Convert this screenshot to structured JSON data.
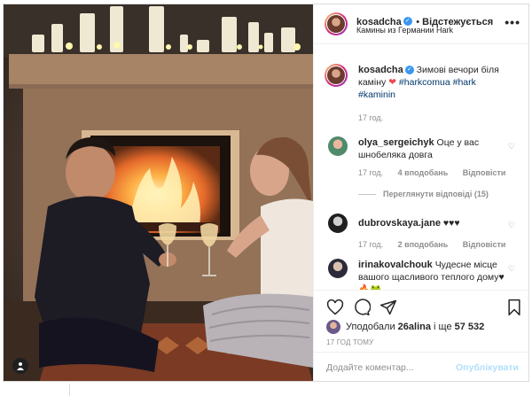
{
  "post": {
    "username": "kosadcha",
    "follow_label": "Відстежується",
    "location": "Камины из Германии Hark",
    "caption_user": "kosadcha",
    "caption_text": "Зимові вечори біля каміну",
    "caption_emoji": "❤",
    "caption_tags": [
      "#harkcomua",
      "#hark",
      "#kaminin"
    ],
    "caption_time": "17 год."
  },
  "comments": [
    {
      "user": "olya_sergeichyk",
      "text": "Оце у вас шнобеляка довга",
      "time": "17 год.",
      "likes": "4 вподобань",
      "reply": "Відповісти",
      "view_replies": "Переглянути відповіді (15)"
    },
    {
      "user": "dubrovskaya.jane",
      "text": "♥♥♥",
      "time": "17 год.",
      "likes": "2 вподобань",
      "reply": "Відповісти"
    },
    {
      "user": "irinakovalchouk",
      "text": "Чудесне місце вашого щасливого теплого дому♥🔥🐸"
    }
  ],
  "likes": {
    "prefix": "Уподобали",
    "user": "26alina",
    "suffix": "і ще",
    "count": "57 532"
  },
  "posted_ago": "17 ГОД ТОМУ",
  "add_comment": {
    "placeholder": "Додайте коментар...",
    "publish": "Опублікувати"
  },
  "icons": {
    "like": "heart-icon",
    "comment": "comment-icon",
    "share": "share-icon",
    "save": "bookmark-icon",
    "more": "more-icon",
    "tag": "user-tag-icon"
  },
  "colors": {
    "link": "#00376b",
    "verified": "#3897f0",
    "muted": "#8e8e8e",
    "publish": "#b2dffc",
    "heart": "#ed4956"
  }
}
